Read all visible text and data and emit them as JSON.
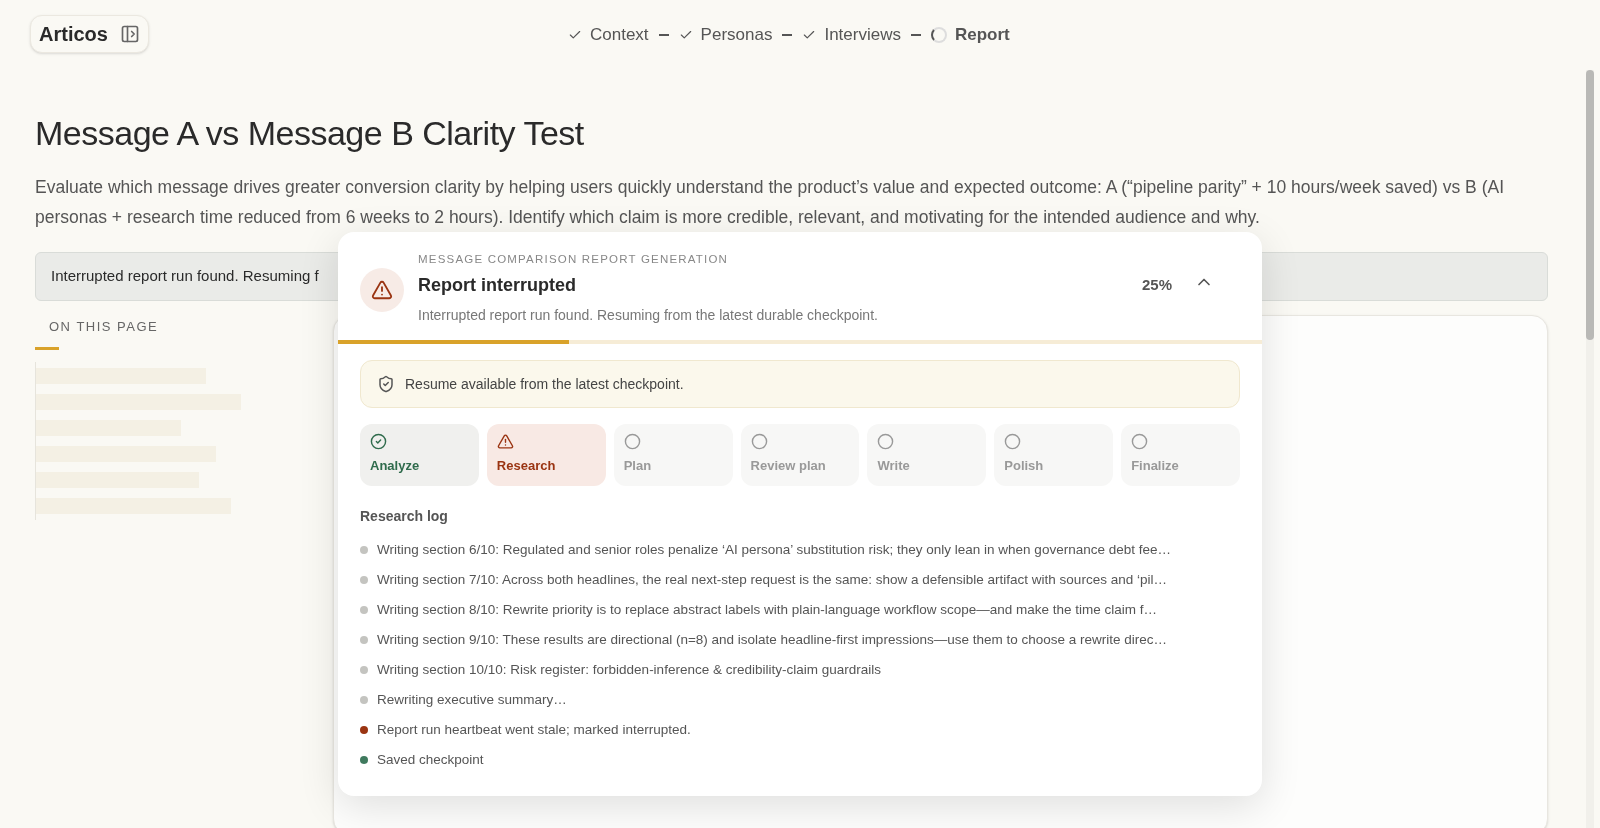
{
  "app": {
    "name": "Articos"
  },
  "stepper": [
    {
      "label": "Context",
      "kind": "done"
    },
    {
      "label": "Personas",
      "kind": "done"
    },
    {
      "label": "Interviews",
      "kind": "done"
    },
    {
      "label": "Report",
      "kind": "active"
    }
  ],
  "page": {
    "title": "Message A vs Message B Clarity Test",
    "description": "Evaluate which message drives greater conversion clarity by helping users quickly understand the product’s value and expected outcome: A (“pipeline parity” + 10 hours/week saved) vs B (AI personas + research time reduced from 6 weeks to 2 hours). Identify which claim is more credible, relevant, and motivating for the intended audience and why.",
    "banner": "Interrupted report run found. Resuming f",
    "toc_heading": "ON THIS PAGE"
  },
  "report_panel": {
    "eyebrow": "MESSAGE COMPARISON REPORT GENERATION",
    "title": "Report interrupted",
    "subtitle": "Interrupted report run found. Resuming from the latest durable checkpoint.",
    "percent": "25%",
    "expanded": true,
    "level": 0.25,
    "notice": "Resume available from the latest checkpoint.",
    "stages": [
      {
        "label": "Analyze",
        "kind": "done"
      },
      {
        "label": "Research",
        "kind": "error"
      },
      {
        "label": "Plan",
        "kind": "pending"
      },
      {
        "label": "Review plan",
        "kind": "pending"
      },
      {
        "label": "Write",
        "kind": "pending"
      },
      {
        "label": "Polish",
        "kind": "pending"
      },
      {
        "label": "Finalize",
        "kind": "pending"
      }
    ],
    "log_title": "Research log",
    "log": [
      {
        "text": "Writing section 6/10: Regulated and senior roles penalize ‘AI persona’ substitution risk; they only lean in when governance debt fee…",
        "color": "#c4c4c0"
      },
      {
        "text": "Writing section 7/10: Across both headlines, the real next-step request is the same: show a defensible artifact with sources and ‘pil…",
        "color": "#c4c4c0"
      },
      {
        "text": "Writing section 8/10: Rewrite priority is to replace abstract labels with plain-language workflow scope—and make the time claim f…",
        "color": "#c4c4c0"
      },
      {
        "text": "Writing section 9/10: These results are directional (n=8) and isolate headline-first impressions—use them to choose a rewrite direc…",
        "color": "#c4c4c0"
      },
      {
        "text": "Writing section 10/10: Risk register: forbidden-inference & credibility-claim guardrails",
        "color": "#c4c4c0"
      },
      {
        "text": "Rewriting executive summary…",
        "color": "#c4c4c0"
      },
      {
        "text": "Report run heartbeat went stale; marked interrupted.",
        "color": "#9a3412"
      },
      {
        "text": "Saved checkpoint",
        "color": "#3f7a5e"
      }
    ]
  }
}
